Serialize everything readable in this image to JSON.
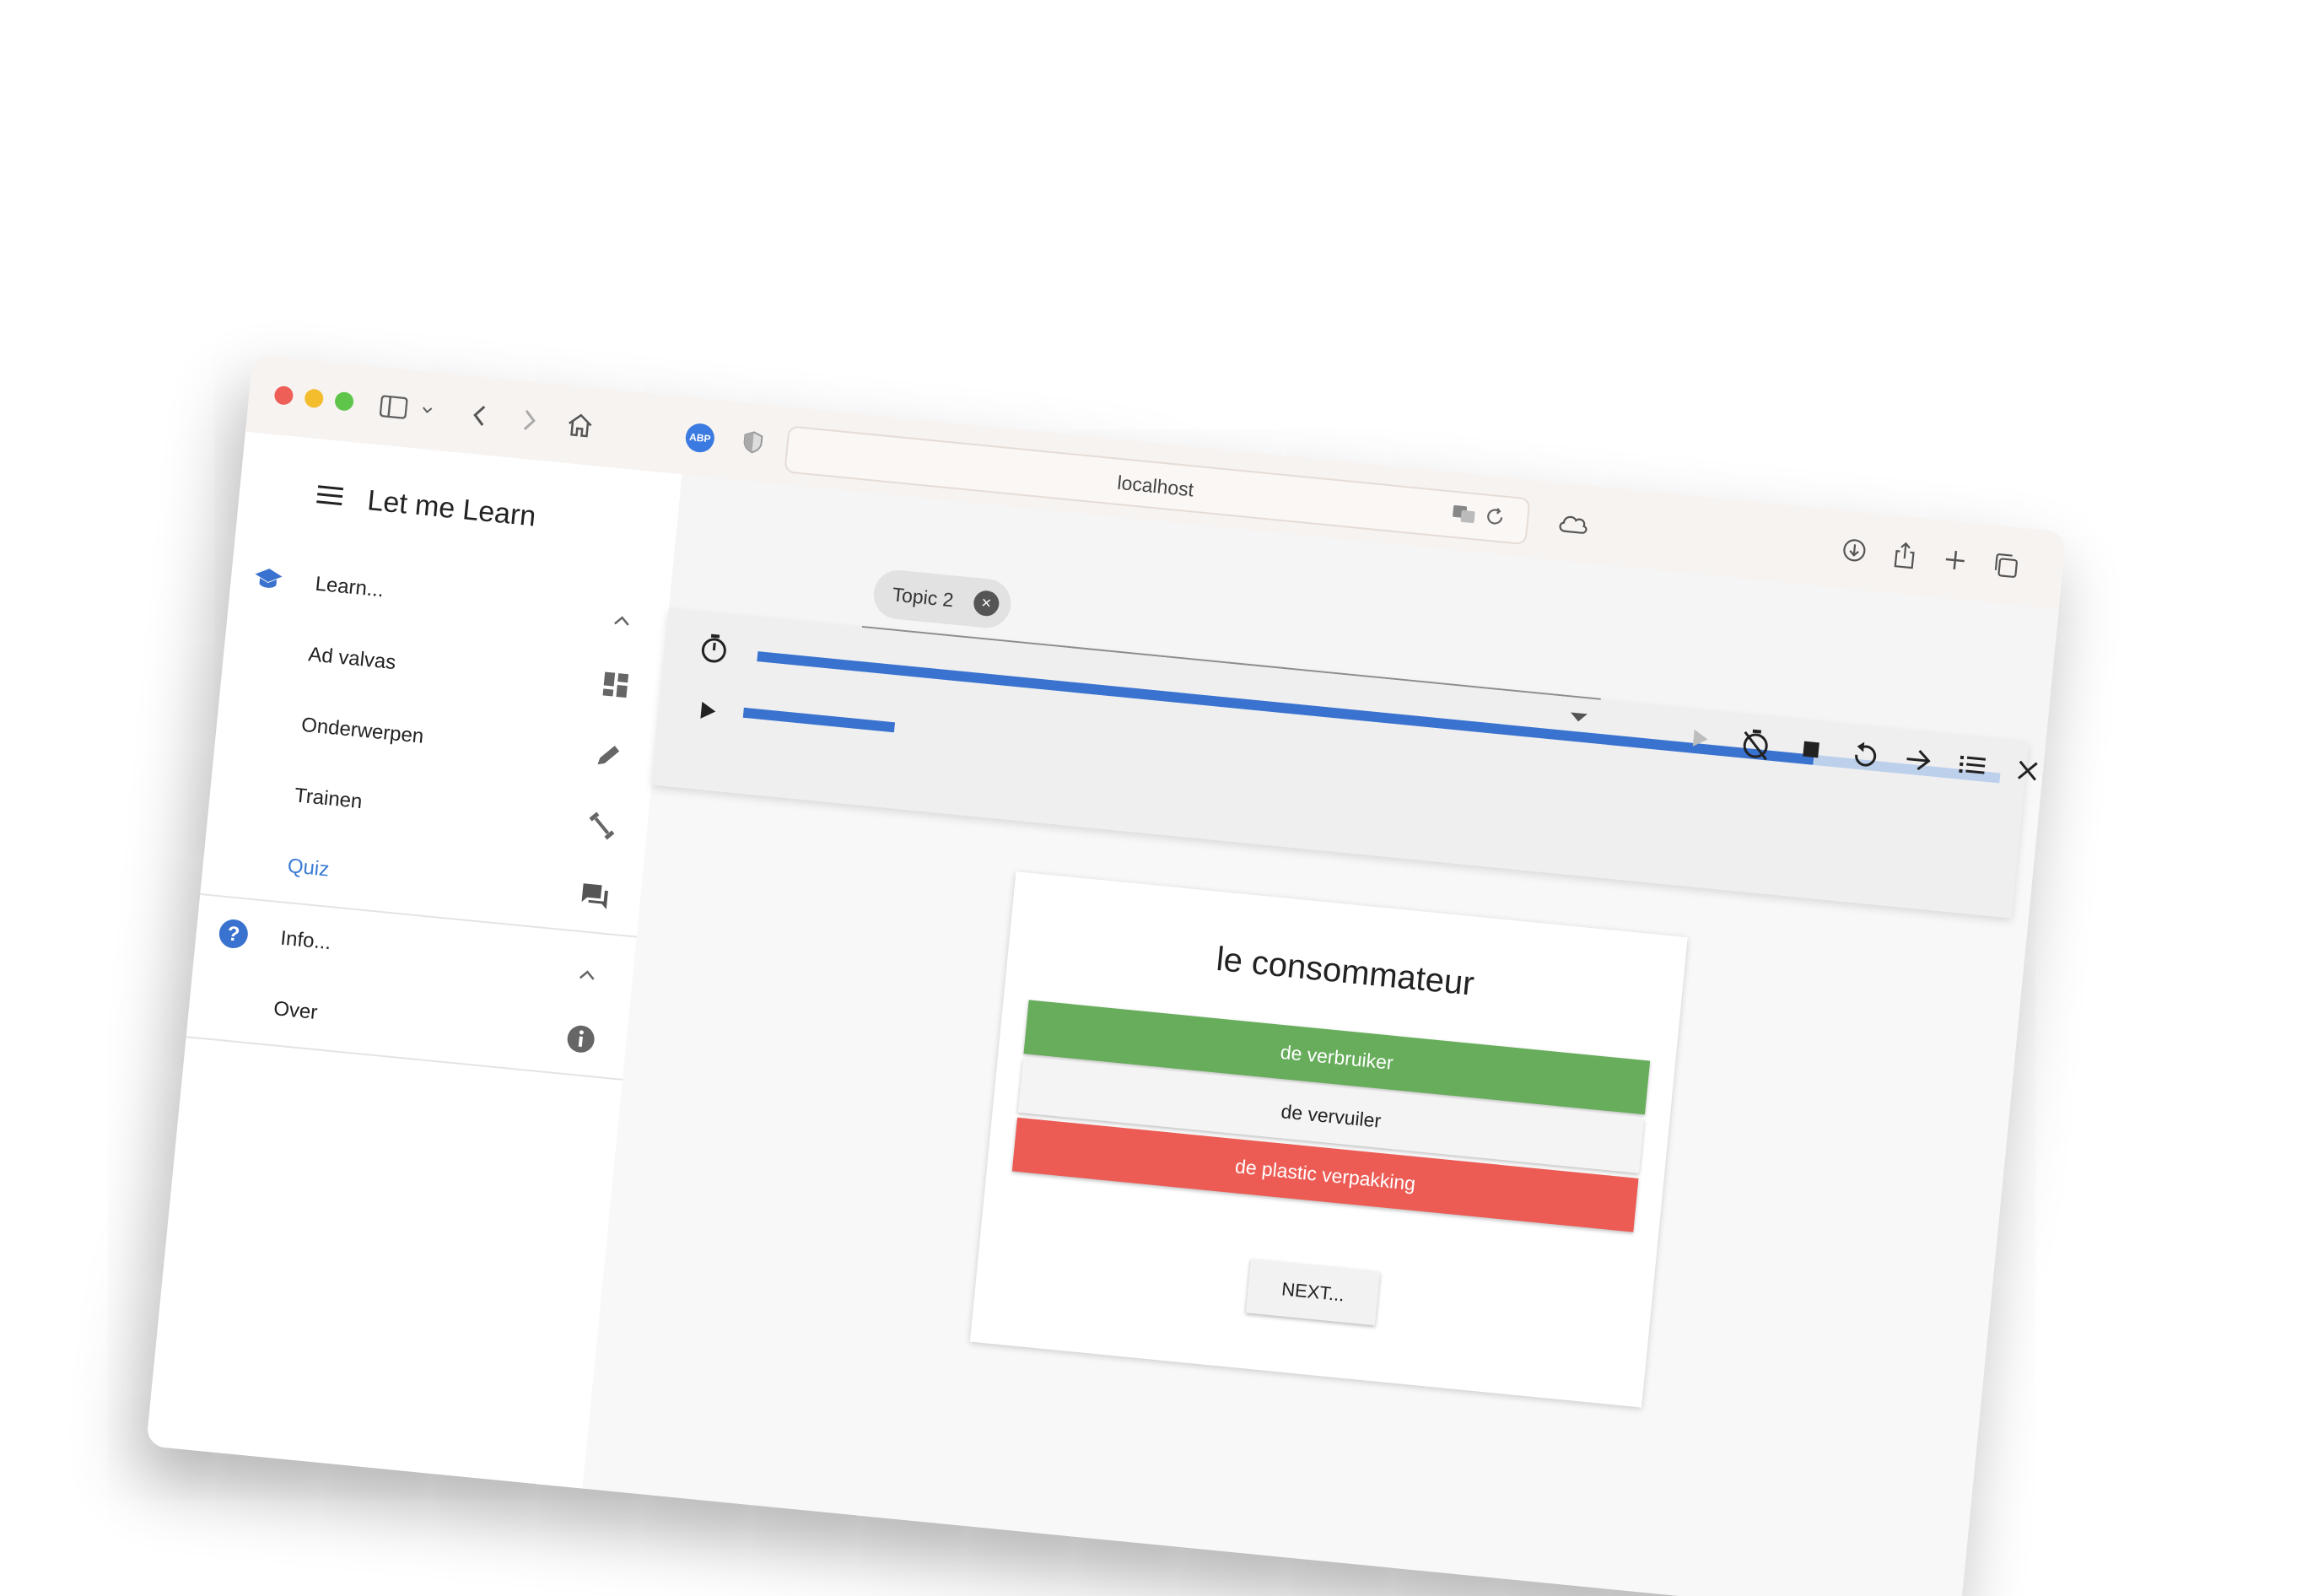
{
  "browser": {
    "url": "localhost",
    "extension_label": "ABP",
    "icons": [
      "sidebar-icon",
      "chevron-down-icon",
      "back-icon",
      "forward-icon",
      "home-icon",
      "shield-icon",
      "translate-icon",
      "reload-icon",
      "cloud-icon",
      "download-icon",
      "share-icon",
      "new-tab-icon",
      "tabs-overview-icon"
    ]
  },
  "app": {
    "title": "Let me Learn"
  },
  "sidebar": {
    "groups": [
      {
        "label": "Learn...",
        "icon": "school-icon",
        "items": [
          {
            "label": "Ad valvas",
            "icon": "dashboard-icon"
          },
          {
            "label": "Onderwerpen",
            "icon": "pencil-icon"
          },
          {
            "label": "Trainen",
            "icon": "dumbbell-icon"
          },
          {
            "label": "Quiz",
            "icon": "forum-icon",
            "active": true
          }
        ]
      },
      {
        "label": "Info...",
        "icon": "help-icon",
        "items": [
          {
            "label": "Over",
            "icon": "info-icon"
          }
        ]
      }
    ]
  },
  "topic_filter": {
    "chip_label": "Topic 2"
  },
  "toolbar": {
    "progress_main": 0.85,
    "progress_small_visible": true,
    "icons": [
      "timer-icon",
      "play-icon",
      "play-disabled-icon",
      "timer-off-icon",
      "stop-icon",
      "replay-icon",
      "arrow-forward-icon",
      "list-icon",
      "close-icon"
    ]
  },
  "quiz": {
    "question": "le consommateur",
    "answers": [
      {
        "label": "de verbruiker",
        "state": "correct"
      },
      {
        "label": "de vervuiler",
        "state": "neutral"
      },
      {
        "label": "de plastic verpakking",
        "state": "wrong"
      }
    ],
    "next_label": "NEXT..."
  },
  "colors": {
    "accent": "#3a72cf",
    "correct": "#67ad5b",
    "wrong": "#ec5c55"
  }
}
